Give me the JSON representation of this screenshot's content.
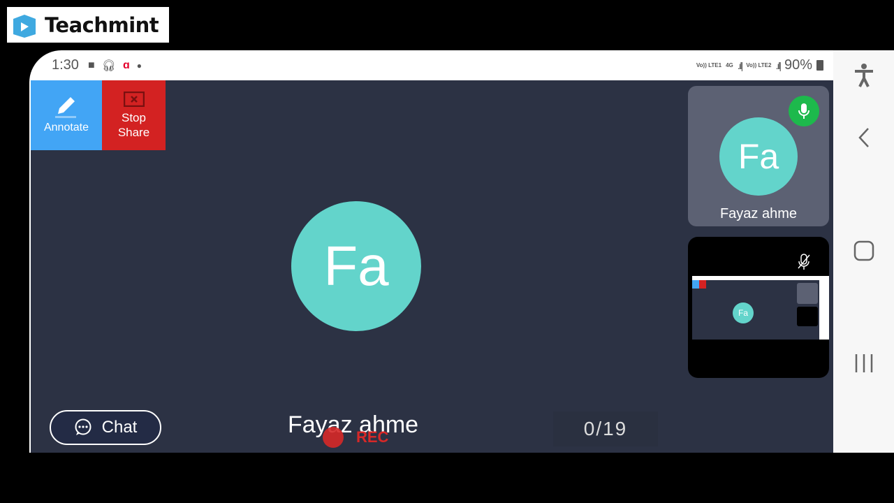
{
  "logo": {
    "text": "Teachmint",
    "brand_color": "#3fa9e0"
  },
  "status_bar": {
    "time": "1:30",
    "network1": "Vo)) LTE1",
    "network_type": "4G",
    "network2": "Vo)) LTE2",
    "battery": "90%",
    "icons": [
      "box-icon",
      "headphones-icon",
      "airtel-icon",
      "dot-icon"
    ]
  },
  "toolbar": {
    "annotate_label": "Annotate",
    "stop_share_label": "Stop Share"
  },
  "main": {
    "avatar_initials": "Fa",
    "presenter_name": "Fayaz ahme",
    "rec_label": "REC",
    "count": "0/19",
    "chat_label": "Chat"
  },
  "participants": [
    {
      "initials": "Fa",
      "name": "Fayaz ahme",
      "mic": "on"
    },
    {
      "mic": "off",
      "content": "screen-share-preview"
    }
  ],
  "colors": {
    "annotate": "#42a5f5",
    "stop_share": "#d32222",
    "avatar": "#63d4cb",
    "mic_on": "#1db94c",
    "background": "#2c3244"
  }
}
